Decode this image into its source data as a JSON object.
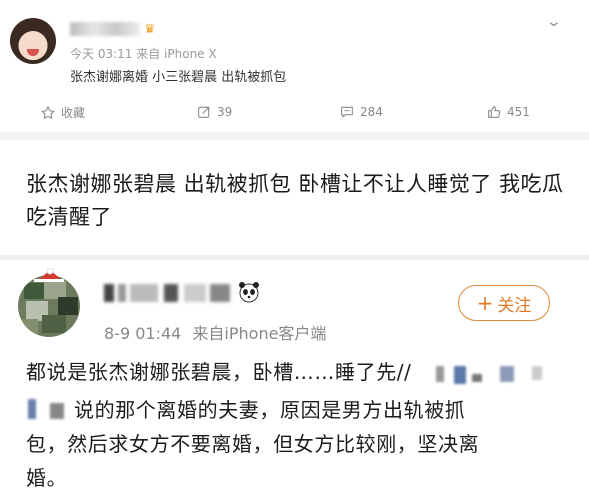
{
  "post": {
    "timestamp": "今天 03:11",
    "source": "来自 iPhone X",
    "text": "张杰谢娜离婚 小三张碧晨 出轨被抓包",
    "actions": {
      "favorite_label": "收藏",
      "repost_count": "39",
      "comment_count": "284",
      "like_count": "451"
    }
  },
  "caption": {
    "text": "张杰谢娜张碧晨 出轨被抓包 卧槽让不让人睡觉了 我吃瓜吃清醒了"
  },
  "comment": {
    "timestamp": "8-9 01:44",
    "source": "来自iPhone客户端",
    "follow_label": "关注",
    "follow_plus": "+",
    "lines": [
      "都说是张杰谢娜张碧晨，卧槽……睡了先//",
      "说的那个离婚的夫妻，原因是男方出轨被抓",
      "包，然后求女方不要离婚，但女方比较刚，坚决离",
      "婚。"
    ]
  },
  "icons": {
    "chevron": "chevron-down-icon",
    "favorite": "star-icon",
    "repost": "repost-icon",
    "comment": "comment-icon",
    "like": "thumbs-up-icon"
  },
  "colors": {
    "accent": "#e07a24",
    "meta_text": "#888888",
    "body_text": "#1d1d1d"
  }
}
